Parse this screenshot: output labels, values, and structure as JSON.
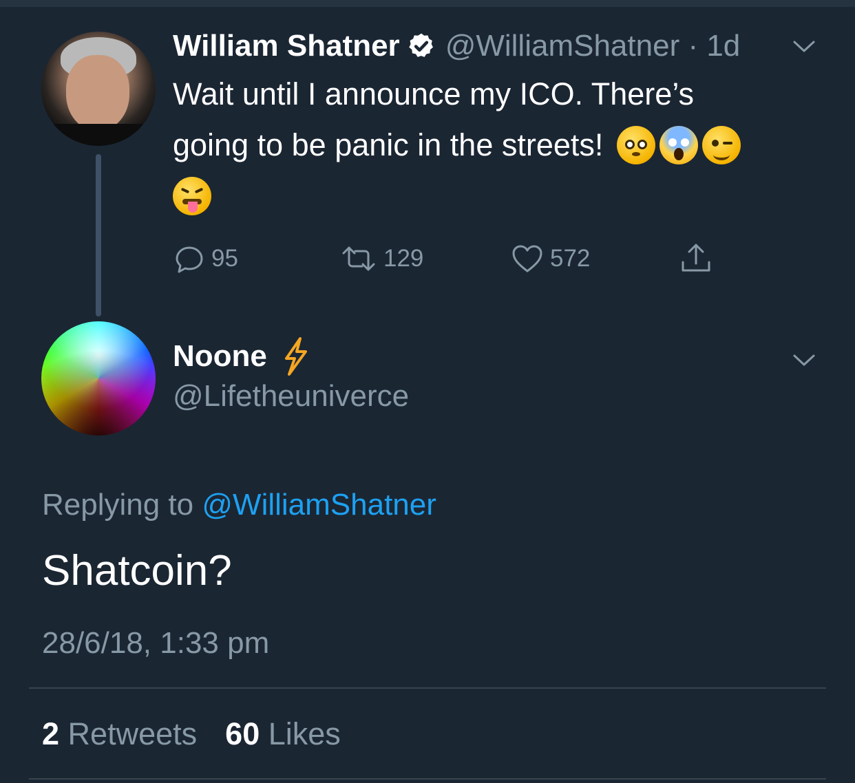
{
  "original_tweet": {
    "display_name": "William Shatner",
    "handle_time": "@WilliamShatner · 1d",
    "text_line1": "Wait until I announce my ICO. There’s",
    "text_line2": "going to be panic in the streets!",
    "emojis": [
      "flushed-face-emoji",
      "screaming-face-emoji",
      "winking-face-emoji",
      "squinting-tongue-face-emoji"
    ],
    "replies": "95",
    "retweets": "129",
    "likes": "572"
  },
  "reply_tweet": {
    "display_name": "Noone",
    "handle": "@Lifetheuniverce",
    "replying_prefix": "Replying to",
    "replying_to": "@WilliamShatner",
    "text": "Shatcoin?",
    "timestamp": "28/6/18, 1:33 pm",
    "retweet_count": "2",
    "retweet_label": "Retweets",
    "like_count": "60",
    "like_label": "Likes"
  },
  "colors": {
    "background": "#1b2633",
    "secondary_text": "#8899a6",
    "mention": "#1da1f2",
    "bolt": "#f5a623"
  }
}
